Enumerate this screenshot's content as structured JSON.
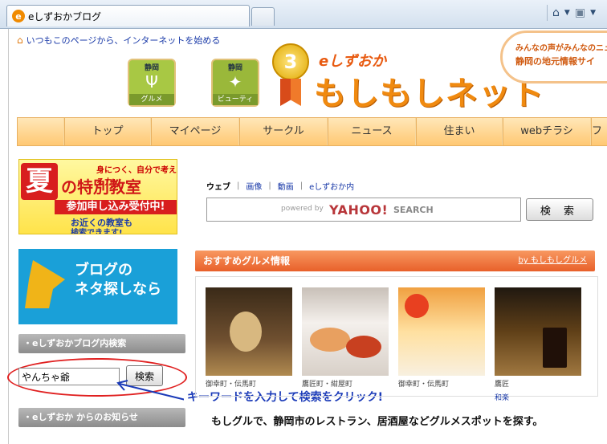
{
  "browser": {
    "tab_title": "eしずおかブログ",
    "favicon_letter": "e"
  },
  "page": {
    "home_link": "いつもこのページから、インターネットを始める",
    "categories": [
      {
        "top": "静岡",
        "label": "グルメ"
      },
      {
        "top": "静岡",
        "label": "ビューティ"
      }
    ],
    "logo": {
      "badge": "3",
      "brand_small": "eしずおか",
      "brand_main": "もしもしネット"
    },
    "bubble": {
      "line1": "みんなの声がみんなのニュース",
      "line2": "静岡の地元情報サイ"
    },
    "nav": [
      "",
      "トップ",
      "マイページ",
      "サークル",
      "ニュース",
      "住まい",
      "webチラシ",
      "フォ"
    ],
    "left": {
      "summer_banner": {
        "kanji": "夏",
        "top": "身につく、自分で考える力!",
        "big": "の特別教室",
        "mid": "参加申し込み受付中!",
        "line1": "お近くの教室も",
        "line2": "検索できます!"
      },
      "blog_banner": {
        "line1": "ブログの",
        "line2": "ネタ探しなら"
      },
      "search_head": "・eしずおかブログ内検索",
      "search_value": "やんちゃ爺",
      "search_button": "検索",
      "news_head": "・eしずおか からのお知らせ"
    },
    "annotation": "キーワードを入力して検索をクリック!",
    "web_search": {
      "tabs": [
        "ウェブ",
        "画像",
        "動画",
        "eしずおか内"
      ],
      "powered_by": "powered by",
      "yahoo": "YAHOO!",
      "search_word": "SEARCH",
      "button": "検 索"
    },
    "gourmet": {
      "head": "おすすめグルメ情報",
      "by": "by もしもしグルメ",
      "captions": [
        "御幸町・伝馬町",
        "鷹匠町・紺屋町",
        "御幸町・伝馬町",
        "鷹匠"
      ],
      "subcaptions": [
        "",
        "",
        "",
        "和楽"
      ],
      "desc": "もしグルで、静岡市のレストラン、居酒屋などグルメスポットを探す。"
    }
  }
}
